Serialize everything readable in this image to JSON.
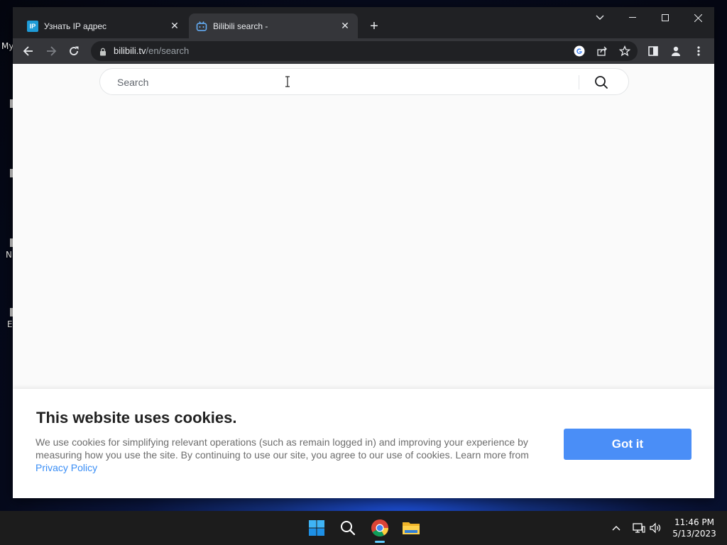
{
  "desktop": {
    "labels": [
      "My",
      "N",
      "E"
    ]
  },
  "browser": {
    "tabs": [
      {
        "title": "Узнать IP адрес",
        "favicon": "IP",
        "active": false
      },
      {
        "title": "Bilibili search -",
        "favicon": "bilibili-icon",
        "active": true
      }
    ],
    "url_host": "bilibili.tv",
    "url_path": "/en/search"
  },
  "page": {
    "search": {
      "placeholder": "Search",
      "value": ""
    },
    "cookie_banner": {
      "title": "This website uses cookies.",
      "text": "We use cookies for simplifying relevant operations (such as remain logged in) and improving your experience by measuring how you use the site. By continuing to use our site, you agree to our use of cookies. Learn more from ",
      "link_text": "Privacy Policy",
      "button_label": "Got it"
    }
  },
  "taskbar": {
    "time": "11:46 PM",
    "date": "5/13/2023"
  },
  "colors": {
    "accent_button": "#4a8ef7",
    "link": "#3a8ef6",
    "tab_bar": "#202124",
    "toolbar": "#35363a"
  }
}
